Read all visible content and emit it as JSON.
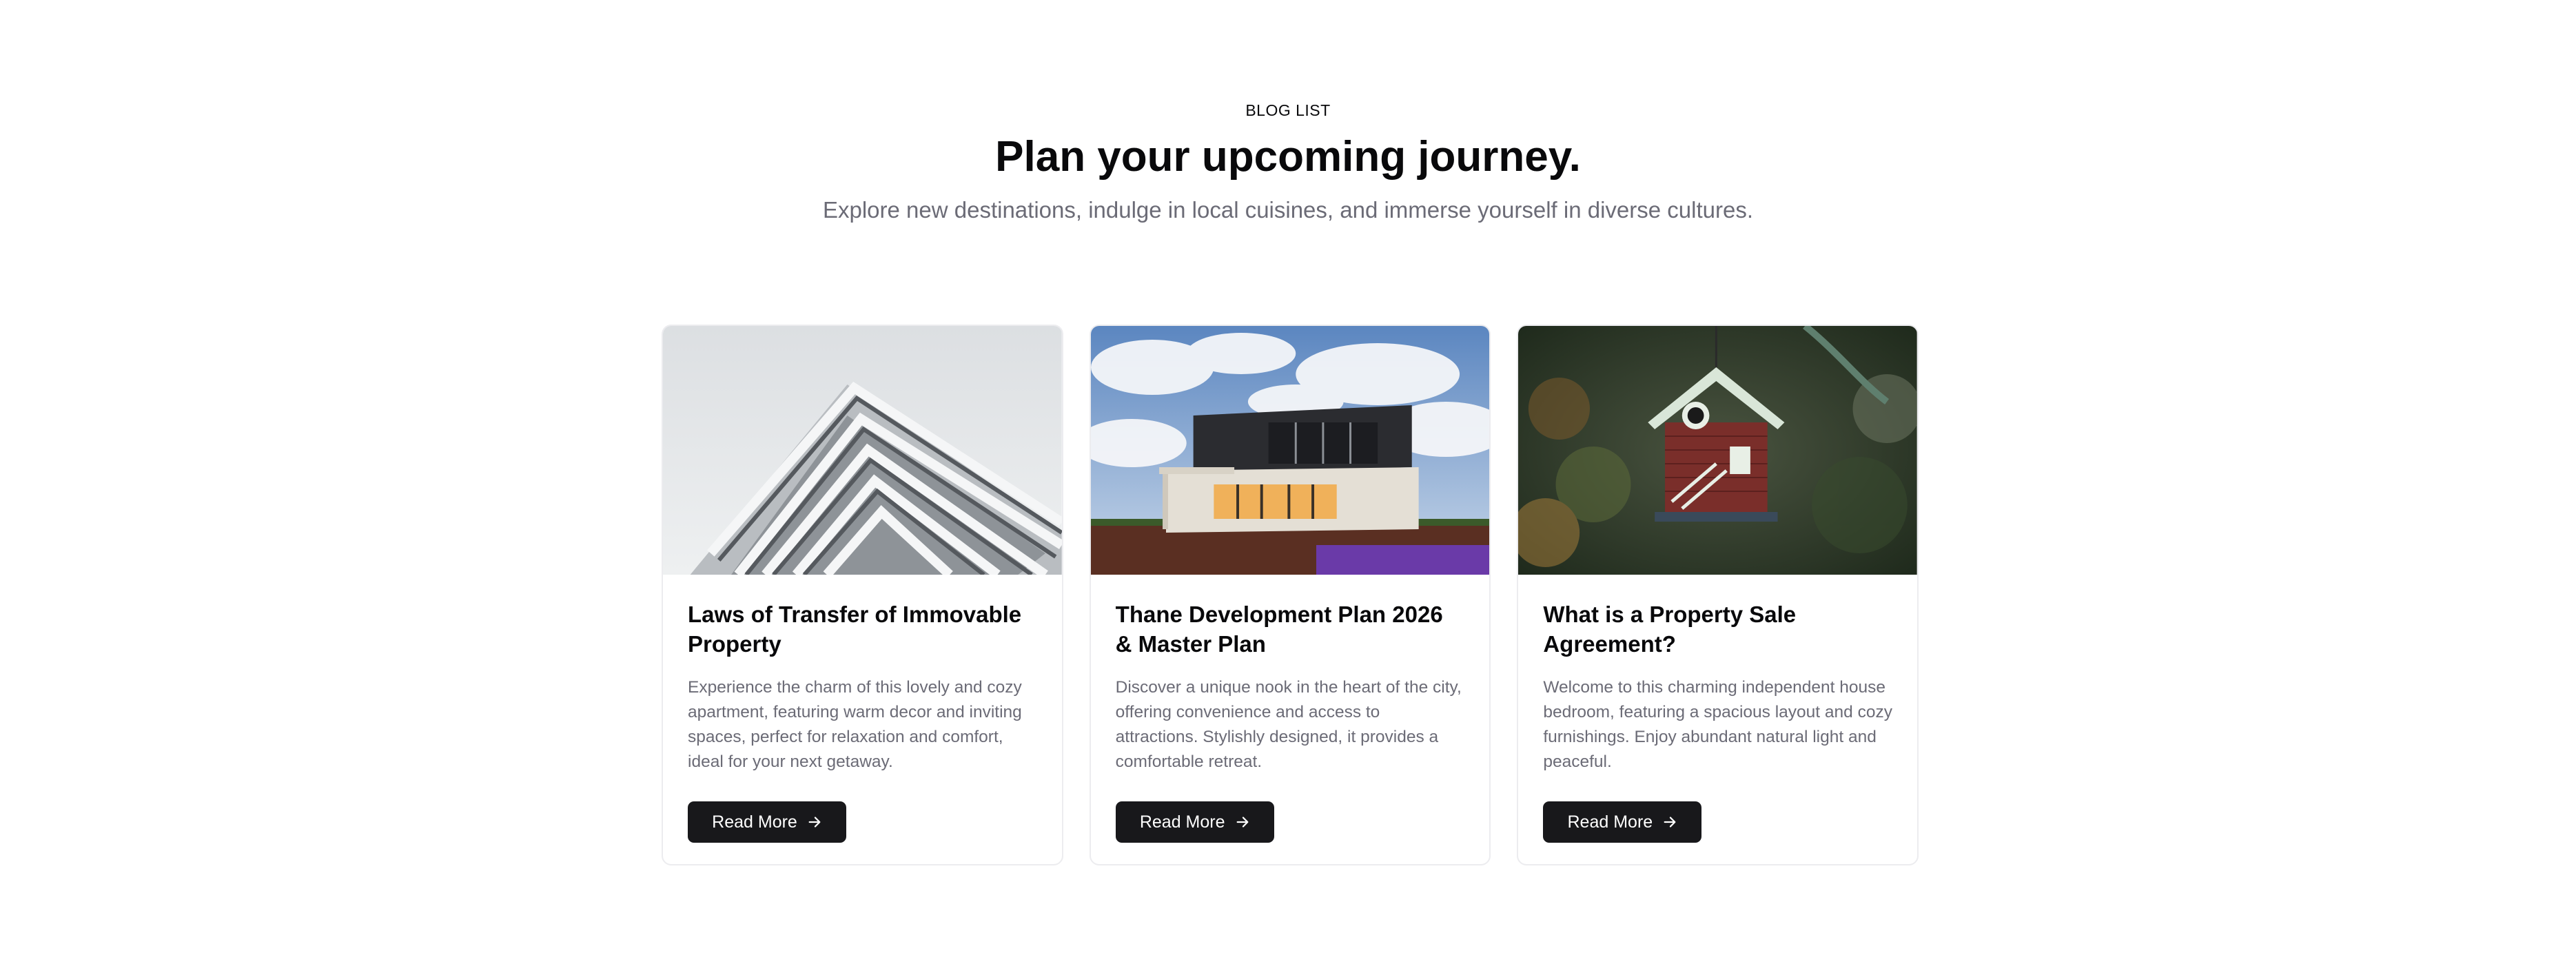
{
  "header": {
    "eyebrow": "BLOG LIST",
    "title": "Plan your upcoming journey.",
    "subtitle": "Explore new destinations, indulge in local cuisines, and immerse yourself in diverse cultures."
  },
  "cards": [
    {
      "title": "Laws of Transfer of Immovable Property",
      "text": "Experience the charm of this lovely and cozy apartment, featuring warm decor and inviting spaces, perfect for relaxation and comfort, ideal for your next getaway.",
      "button_label": "Read More",
      "button_icon": "arrow-right-icon"
    },
    {
      "title": "Thane Development Plan 2026 & Master Plan",
      "text": "Discover a unique nook in the heart of the city, offering convenience and access to attractions. Stylishly designed, it provides a comfortable retreat.",
      "button_label": "Read More",
      "button_icon": "arrow-right-icon"
    },
    {
      "title": "What is a Property Sale Agreement?",
      "text": "Welcome to this charming independent house bedroom, featuring a spacious layout and cozy furnishings. Enjoy abundant natural light and peaceful.",
      "button_label": "Read More",
      "button_icon": "arrow-right-icon"
    }
  ],
  "colors": {
    "button_bg": "#18181b",
    "muted_text": "#6b6b76",
    "card_border": "#ececef"
  }
}
